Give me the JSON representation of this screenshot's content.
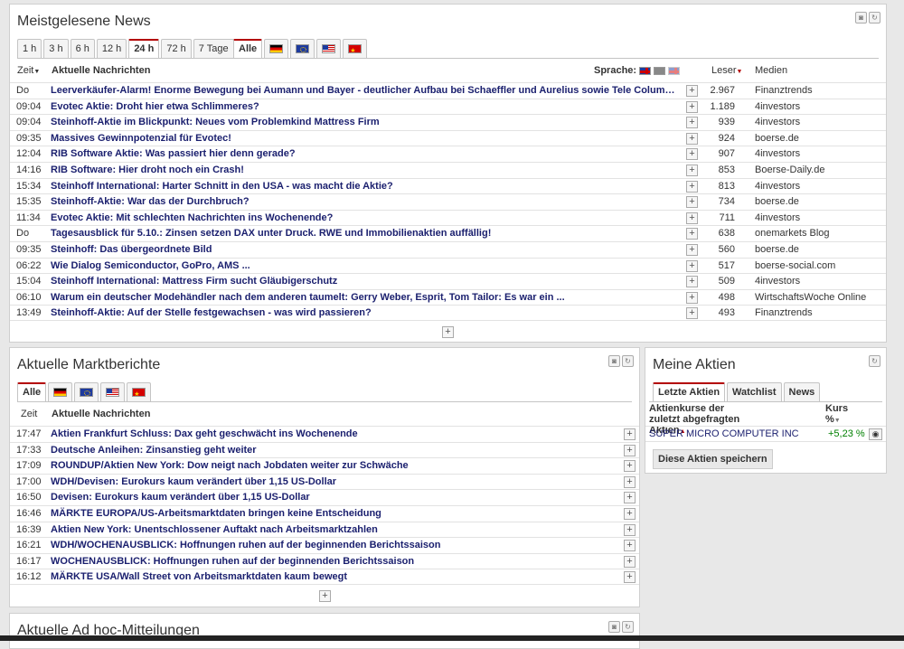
{
  "colors": {
    "accent": "#b30000",
    "link": "#1a1f6e",
    "positive": "#008000"
  },
  "news_panel": {
    "title": "Meistgelesene News",
    "time_tabs": [
      "1 h",
      "3 h",
      "6 h",
      "12 h",
      "24 h",
      "72 h",
      "7 Tage"
    ],
    "active_time_tab": "24 h",
    "lang_tab_all": "Alle",
    "col_time": "Zeit",
    "col_news": "Aktuelle Nachrichten",
    "col_lang": "Sprache:",
    "col_readers": "Leser",
    "col_media": "Medien",
    "rows": [
      {
        "time": "Do",
        "title": "Leerverkäufer-Alarm! Enorme Bewegung bei Aumann und Bayer - deutlicher Aufbau bei Schaeffler und Aurelius sowie Tele Columbus u...",
        "readers": "2.967",
        "media": "Finanztrends"
      },
      {
        "time": "09:04",
        "title": "Evotec Aktie: Droht hier etwa Schlimmeres?",
        "readers": "1.189",
        "media": "4investors"
      },
      {
        "time": "09:04",
        "title": "Steinhoff-Aktie im Blickpunkt: Neues vom Problemkind Mattress Firm",
        "readers": "939",
        "media": "4investors"
      },
      {
        "time": "09:35",
        "title": "Massives Gewinnpotenzial für Evotec!",
        "readers": "924",
        "media": "boerse.de"
      },
      {
        "time": "12:04",
        "title": "RIB Software Aktie: Was passiert hier denn gerade?",
        "readers": "907",
        "media": "4investors"
      },
      {
        "time": "14:16",
        "title": "RIB Software: Hier droht noch ein Crash!",
        "readers": "853",
        "media": "Boerse-Daily.de"
      },
      {
        "time": "15:34",
        "title": "Steinhoff International: Harter Schnitt in den USA - was macht die Aktie?",
        "readers": "813",
        "media": "4investors"
      },
      {
        "time": "15:35",
        "title": "Steinhoff-Aktie: War das der Durchbruch?",
        "readers": "734",
        "media": "boerse.de"
      },
      {
        "time": "11:34",
        "title": "Evotec Aktie: Mit schlechten Nachrichten ins Wochenende?",
        "readers": "711",
        "media": "4investors"
      },
      {
        "time": "Do",
        "title": "Tagesausblick für 5.10.: Zinsen setzen DAX unter Druck. RWE und Immobilienaktien auffällig!",
        "readers": "638",
        "media": "onemarkets Blog"
      },
      {
        "time": "09:35",
        "title": "Steinhoff: Das übergeordnete Bild",
        "readers": "560",
        "media": "boerse.de"
      },
      {
        "time": "06:22",
        "title": "Wie Dialog Semiconductor, GoPro, AMS ...",
        "readers": "517",
        "media": "boerse-social.com"
      },
      {
        "time": "15:04",
        "title": "Steinhoff International: Mattress Firm sucht Gläubigerschutz",
        "readers": "509",
        "media": "4investors"
      },
      {
        "time": "06:10",
        "title": "Warum ein deutscher Modehändler nach dem anderen taumelt: Gerry Weber, Esprit, Tom Tailor: Es war ein ...",
        "readers": "498",
        "media": "WirtschaftsWoche Online"
      },
      {
        "time": "13:49",
        "title": "Steinhoff-Aktie: Auf der Stelle festgewachsen - was wird passieren?",
        "readers": "493",
        "media": "Finanztrends"
      }
    ]
  },
  "market_panel": {
    "title": "Aktuelle Marktberichte",
    "lang_tab_all": "Alle",
    "col_time": "Zeit",
    "col_news": "Aktuelle Nachrichten",
    "rows": [
      {
        "time": "17:47",
        "title": "Aktien Frankfurt Schluss: Dax geht geschwächt ins Wochenende"
      },
      {
        "time": "17:33",
        "title": "Deutsche Anleihen: Zinsanstieg geht weiter"
      },
      {
        "time": "17:09",
        "title": "ROUNDUP/Aktien New York: Dow neigt nach Jobdaten weiter zur Schwäche"
      },
      {
        "time": "17:00",
        "title": "WDH/Devisen: Eurokurs kaum verändert über 1,15 US-Dollar"
      },
      {
        "time": "16:50",
        "title": "Devisen: Eurokurs kaum verändert über 1,15 US-Dollar"
      },
      {
        "time": "16:46",
        "title": "MÄRKTE EUROPA/US-Arbeitsmarktdaten bringen keine Entscheidung"
      },
      {
        "time": "16:39",
        "title": "Aktien New York: Unentschlossener Auftakt nach Arbeitsmarktzahlen"
      },
      {
        "time": "16:21",
        "title": "WDH/WOCHENAUSBLICK: Hoffnungen ruhen auf der beginnenden Berichtssaison"
      },
      {
        "time": "16:17",
        "title": "WOCHENAUSBLICK: Hoffnungen ruhen auf der beginnenden Berichtssaison"
      },
      {
        "time": "16:12",
        "title": "MÄRKTE USA/Wall Street von Arbeitsmarktdaten kaum bewegt"
      }
    ]
  },
  "stocks_panel": {
    "title": "Meine Aktien",
    "tabs": [
      "Letzte Aktien",
      "Watchlist",
      "News"
    ],
    "active_tab": "Letzte Aktien",
    "col_name": "Aktienkurse der zuletzt abgefragten Aktien",
    "col_change_top": "Kurs",
    "col_change_bottom": "%",
    "stock_name": "SUPER MICRO COMPUTER INC",
    "stock_change": "+5,23 %",
    "save_button": "Diese Aktien speichern"
  },
  "adhoc_panel": {
    "title": "Aktuelle Ad hoc-Mitteilungen"
  }
}
